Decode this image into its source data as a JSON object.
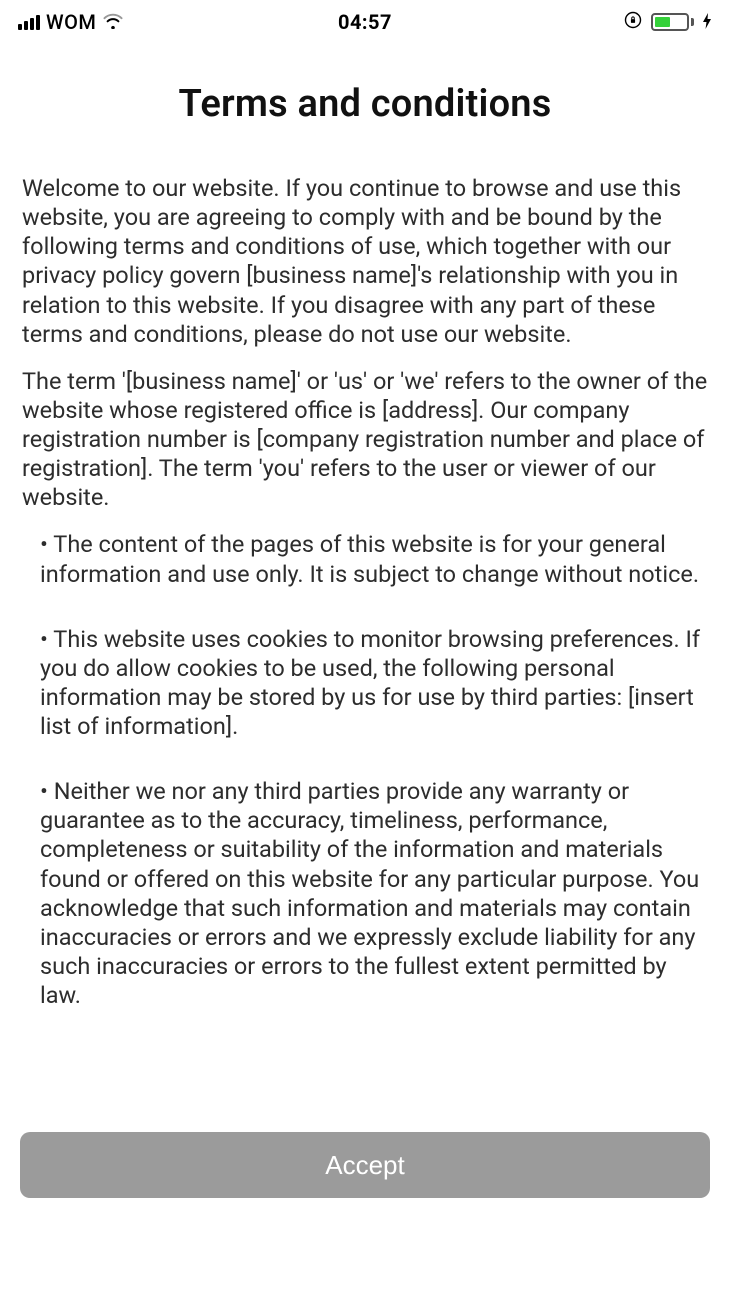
{
  "status_bar": {
    "carrier": "WOM",
    "time": "04:57"
  },
  "title": "Terms and conditions",
  "paragraphs": {
    "p1": "Welcome to our website. If you continue to browse and use this website, you are agreeing to comply with and be bound by the following terms and conditions of use, which together with our privacy policy govern [business name]'s relationship with you in relation to this website. If you disagree with any part of these terms and conditions, please do not use our website.",
    "p2": "The term '[business name]' or 'us' or 'we' refers to the owner of the website whose registered office is [address]. Our company registration number is [company registration number and place of registration]. The term 'you' refers to the user or viewer of our website."
  },
  "bullets": {
    "b1": "• The content of the pages of this website is for your general information and use only. It is subject to change without notice.",
    "b2": "• This website uses cookies to monitor browsing preferences. If you do allow cookies to be used, the following personal information may be stored by us for use by third parties: [insert list of information].",
    "b3": "• Neither we nor any third parties provide any warranty or guarantee as to the accuracy, timeliness, performance, completeness or suitability of the information and materials found or offered on this website for any particular purpose. You acknowledge that such information and materials may contain inaccuracies or errors and we expressly exclude liability for any such inaccuracies or errors to the fullest extent permitted by law."
  },
  "accept_label": "Accept"
}
